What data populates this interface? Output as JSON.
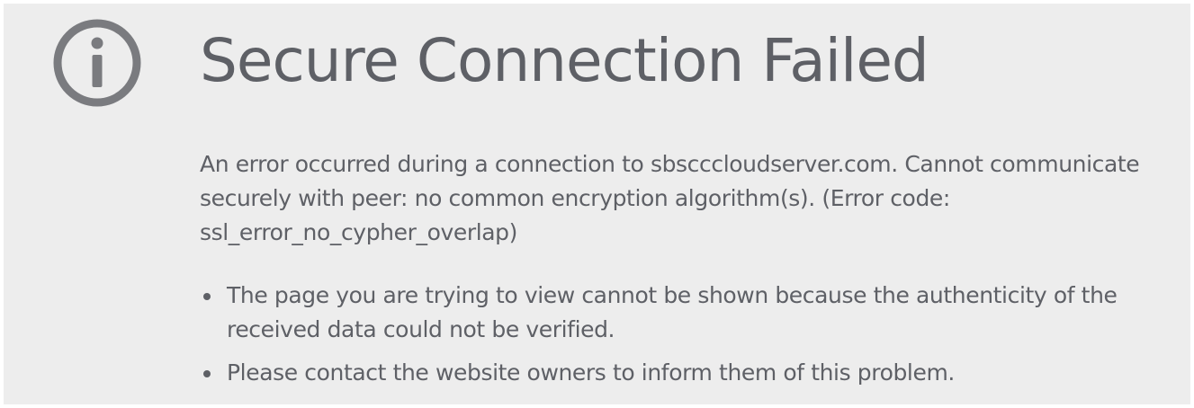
{
  "error_page": {
    "icon": "info-icon",
    "title": "Secure Connection Failed",
    "description": "An error occurred during a connection to sbscccloudserver.com. Cannot communicate securely with peer: no common encryption algorithm(s). (Error code: ssl_error_no_cypher_overlap)",
    "reasons": [
      "The page you are trying to view cannot be shown because the authenticity of the received data could not be verified.",
      "Please contact the website owners to inform them of this problem."
    ]
  },
  "colors": {
    "background": "#ededed",
    "text": "#5e6066",
    "icon": "#7a7b7f"
  }
}
